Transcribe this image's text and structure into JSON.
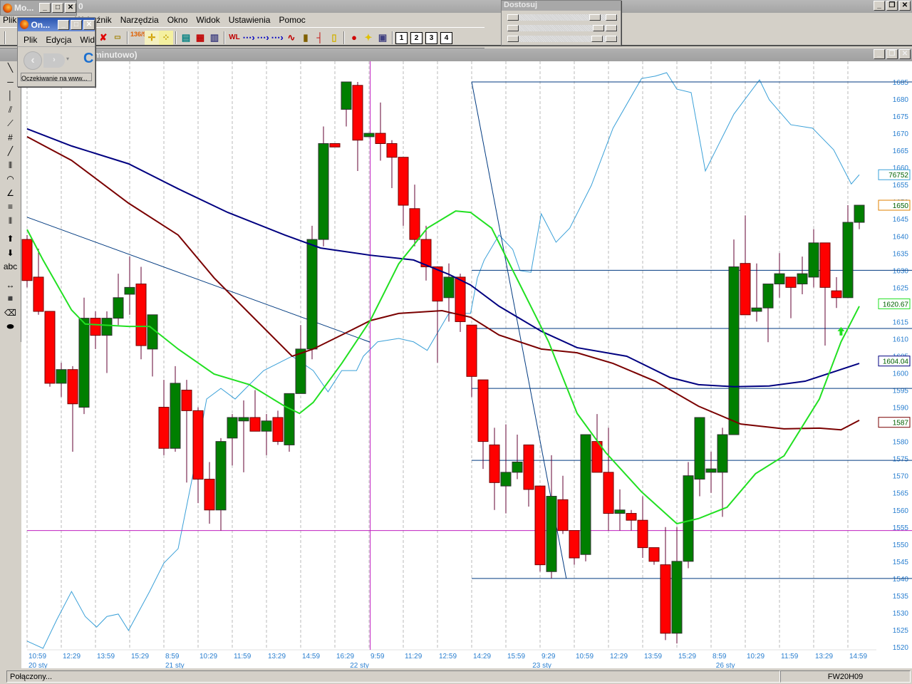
{
  "main_window": {
    "title_fragment": "Mo...",
    "title_tail": "0"
  },
  "menu": [
    "Plik",
    "Wskaźnik",
    "Narzędzia",
    "Okno",
    "Widok",
    "Ustawienia",
    "Pomoc"
  ],
  "toolbar": {
    "icons": [
      "close-chart",
      "ruler",
      "values-136-90",
      "crosshair",
      "dotted-crosshair",
      "table",
      "layout-grid",
      "list",
      "wl-marker",
      "arrow-1",
      "arrow-2",
      "arrow-3",
      "line-chart",
      "bar-chart",
      "ohlc-bar",
      "candlestick",
      "traffic-light",
      "bulb-add",
      "add-window"
    ],
    "values_label": "136/90",
    "wl_label": "WL",
    "layout_buttons": [
      "1",
      "2",
      "3",
      "4"
    ]
  },
  "adjust_panel": {
    "title": "Dostosuj",
    "sliders": [
      0.82,
      0.88,
      0.86
    ]
  },
  "chart_window": {
    "title": "minutowo)"
  },
  "left_tools": [
    "line",
    "horizontal-line",
    "vertical-line",
    "parallel-lines",
    "fan",
    "andrews-pitchfork",
    "trendline",
    "vertical-lines",
    "arcs",
    "angle-fan",
    "fibonacci-levels",
    "time-zones",
    "arrow-up",
    "arrow-down",
    "text",
    "measure",
    "point",
    "eraser",
    "erase-all"
  ],
  "left_tools_text_label": "abc",
  "browser_popup": {
    "title": "On...",
    "menu": [
      "Plik",
      "Edycja",
      "Wid"
    ],
    "status": "Oczekiwanie na www..."
  },
  "status_bar": {
    "connection": "Połączony...",
    "symbol": "FW20H09"
  },
  "colors": {
    "up": "#007f00",
    "down": "#ff0000",
    "ma_fast": "#22e022",
    "ma_mid": "#000080",
    "ma_slow": "#7a0000",
    "overlay": "#3aa0d8",
    "level": "#003a80",
    "cursor": "#c020c0"
  },
  "chart_data": {
    "type": "candlestick",
    "symbol": "FW20H09",
    "ylim": [
      1520,
      1685
    ],
    "y_ticks": [
      1685,
      1680,
      1675,
      1670,
      1665,
      1660,
      1655,
      1650,
      1645,
      1640,
      1635,
      1630,
      1625,
      1620,
      1615,
      1610,
      1605,
      1600,
      1595,
      1590,
      1585,
      1580,
      1575,
      1570,
      1565,
      1560,
      1555,
      1550,
      1545,
      1540,
      1535,
      1530,
      1525,
      1520
    ],
    "x_ticks": [
      {
        "i": 0,
        "label": "10:59"
      },
      {
        "i": 3,
        "label": "12:29"
      },
      {
        "i": 6,
        "label": "13:59"
      },
      {
        "i": 9,
        "label": "15:29"
      },
      {
        "i": 12,
        "label": "8:59"
      },
      {
        "i": 15,
        "label": "10:29"
      },
      {
        "i": 18,
        "label": "11:59"
      },
      {
        "i": 21,
        "label": "13:29"
      },
      {
        "i": 24,
        "label": "14:59"
      },
      {
        "i": 27,
        "label": "16:29"
      },
      {
        "i": 30,
        "label": "9:59"
      },
      {
        "i": 33,
        "label": "11:29"
      },
      {
        "i": 36,
        "label": "12:59"
      },
      {
        "i": 39,
        "label": "14:29"
      },
      {
        "i": 42,
        "label": "15:59"
      },
      {
        "i": 45,
        "label": "9:29"
      },
      {
        "i": 48,
        "label": "10:59"
      },
      {
        "i": 51,
        "label": "12:29"
      },
      {
        "i": 54,
        "label": "13:59"
      },
      {
        "i": 57,
        "label": "15:29"
      },
      {
        "i": 60,
        "label": "8:59"
      },
      {
        "i": 63,
        "label": "10:29"
      },
      {
        "i": 66,
        "label": "11:59"
      },
      {
        "i": 69,
        "label": "13:29"
      },
      {
        "i": 72,
        "label": "14:59"
      }
    ],
    "date_labels": [
      {
        "i": 0,
        "label": "20 sty"
      },
      {
        "i": 12,
        "label": "21 sty"
      },
      {
        "i": 28.2,
        "label": "22 sty"
      },
      {
        "i": 44.2,
        "label": "23 sty"
      },
      {
        "i": 60.3,
        "label": "26 sty"
      }
    ],
    "ohlc": [
      [
        1639,
        1640.3,
        1625,
        1627
      ],
      [
        1628,
        1636.3,
        1617,
        1618
      ],
      [
        1618,
        1618,
        1596,
        1597
      ],
      [
        1597,
        1603,
        1593,
        1601
      ],
      [
        1601,
        1602,
        1577,
        1591
      ],
      [
        1590,
        1622,
        1588,
        1616
      ],
      [
        1616,
        1618,
        1607,
        1611
      ],
      [
        1611,
        1618,
        1600,
        1616
      ],
      [
        1616,
        1629,
        1614,
        1622
      ],
      [
        1623,
        1634,
        1617,
        1625
      ],
      [
        1626,
        1631,
        1604,
        1608
      ],
      [
        1607,
        1617,
        1599,
        1617
      ],
      [
        1590,
        1598,
        1576,
        1578
      ],
      [
        1578,
        1602,
        1577,
        1597
      ],
      [
        1595,
        1598,
        1568,
        1589
      ],
      [
        1589,
        1590,
        1562,
        1569
      ],
      [
        1569,
        1574,
        1556,
        1560
      ],
      [
        1560,
        1581,
        1554,
        1580
      ],
      [
        1581,
        1588,
        1573,
        1587
      ],
      [
        1586,
        1592,
        1571,
        1587
      ],
      [
        1587,
        1595,
        1583,
        1583
      ],
      [
        1583,
        1588,
        1576,
        1586
      ],
      [
        1587,
        1589,
        1579,
        1580
      ],
      [
        1579,
        1594,
        1577,
        1594
      ],
      [
        1594,
        1614,
        1594,
        1607
      ],
      [
        1607,
        1643,
        1604,
        1639
      ],
      [
        1639,
        1672,
        1637,
        1667
      ],
      [
        1667,
        1667,
        1666,
        1666
      ],
      [
        1677,
        1685,
        1672,
        1685
      ],
      [
        1684,
        1685,
        1659,
        1668
      ],
      [
        1669,
        1670,
        1669,
        1670
      ],
      [
        1670,
        1679,
        1662,
        1667
      ],
      [
        1667,
        1668,
        1654,
        1663
      ],
      [
        1663,
        1663,
        1643,
        1649
      ],
      [
        1648,
        1655,
        1637,
        1639
      ],
      [
        1639,
        1643,
        1627,
        1631
      ],
      [
        1631,
        1631,
        1603,
        1621
      ],
      [
        1622,
        1632,
        1615,
        1628
      ],
      [
        1628,
        1629,
        1612,
        1615
      ],
      [
        1614,
        1614,
        1593,
        1599
      ],
      [
        1598,
        1598,
        1572,
        1580
      ],
      [
        1579,
        1584,
        1560,
        1568
      ],
      [
        1567,
        1585,
        1559,
        1571
      ],
      [
        1571,
        1582,
        1569,
        1574
      ],
      [
        1579,
        1579,
        1561,
        1566
      ],
      [
        1567,
        1567,
        1542,
        1544
      ],
      [
        1542,
        1576,
        1540,
        1564
      ],
      [
        1563,
        1570,
        1553,
        1554
      ],
      [
        1554,
        1554,
        1544,
        1546
      ],
      [
        1547,
        1582,
        1545,
        1582
      ],
      [
        1580,
        1588,
        1571,
        1571
      ],
      [
        1571,
        1584,
        1554,
        1559
      ],
      [
        1559,
        1566,
        1554,
        1560
      ],
      [
        1559,
        1560,
        1554,
        1557
      ],
      [
        1557,
        1564,
        1546,
        1549
      ],
      [
        1549,
        1549,
        1544,
        1545
      ],
      [
        1544,
        1555,
        1522,
        1524
      ],
      [
        1524,
        1555,
        1521,
        1545
      ],
      [
        1545,
        1574,
        1543,
        1570
      ],
      [
        1569,
        1587,
        1564,
        1587
      ],
      [
        1571,
        1577,
        1565,
        1572
      ],
      [
        1571,
        1584,
        1558,
        1582
      ],
      [
        1582,
        1639,
        1582,
        1631
      ],
      [
        1632,
        1646,
        1617,
        1617
      ],
      [
        1618,
        1632,
        1615,
        1619
      ],
      [
        1619,
        1626,
        1609,
        1626
      ],
      [
        1626,
        1635,
        1622,
        1629
      ],
      [
        1628,
        1628,
        1616,
        1625
      ],
      [
        1626,
        1634,
        1623,
        1629
      ],
      [
        1628,
        1642,
        1625,
        1638
      ],
      [
        1638,
        1638,
        1608,
        1625
      ],
      [
        1624,
        1628,
        1619,
        1622
      ],
      [
        1622,
        1649,
        1622,
        1644
      ],
      [
        1644,
        1649,
        1642,
        1649
      ]
    ],
    "series": [
      {
        "name": "ma-mid",
        "color_key": "ma_mid",
        "points": [
          [
            0,
            1671.3
          ],
          [
            3.9,
            1666.3
          ],
          [
            8.9,
            1661.1
          ],
          [
            13.25,
            1653.8
          ],
          [
            17.6,
            1646.9
          ],
          [
            22.6,
            1640.3
          ],
          [
            25.75,
            1636.5
          ],
          [
            30.1,
            1634.4
          ],
          [
            33.9,
            1633
          ],
          [
            37,
            1628.8
          ],
          [
            38.9,
            1625.7
          ],
          [
            41.4,
            1619.5
          ],
          [
            45.1,
            1612.2
          ],
          [
            48.25,
            1607.4
          ],
          [
            52.6,
            1604.9
          ],
          [
            56.4,
            1598.7
          ],
          [
            58.9,
            1596.6
          ],
          [
            62,
            1596
          ],
          [
            65.1,
            1596.2
          ],
          [
            68.25,
            1597.6
          ],
          [
            73,
            1602.8
          ]
        ]
      },
      {
        "name": "ma-slow",
        "color_key": "ma_slow",
        "points": [
          [
            0,
            1669
          ],
          [
            3.9,
            1662.1
          ],
          [
            8.9,
            1649.6
          ],
          [
            13.25,
            1640.3
          ],
          [
            16.4,
            1627.8
          ],
          [
            19.5,
            1617.4
          ],
          [
            23.25,
            1604.9
          ],
          [
            25.1,
            1607
          ],
          [
            27.6,
            1611.1
          ],
          [
            30.1,
            1615.3
          ],
          [
            32.6,
            1617.4
          ],
          [
            36.4,
            1618.2
          ],
          [
            38.9,
            1616.3
          ],
          [
            41.4,
            1611.1
          ],
          [
            45.1,
            1607
          ],
          [
            48.25,
            1605.9
          ],
          [
            51.4,
            1602.8
          ],
          [
            55.1,
            1597.6
          ],
          [
            58.9,
            1590.3
          ],
          [
            62.6,
            1585.1
          ],
          [
            66.4,
            1583.7
          ],
          [
            69.5,
            1583.9
          ],
          [
            71.4,
            1583.4
          ],
          [
            73,
            1586.2
          ]
        ]
      },
      {
        "name": "ma-fast",
        "color_key": "ma_fast",
        "points": [
          [
            0,
            1641.9
          ],
          [
            1.4,
            1633
          ],
          [
            3.9,
            1618.4
          ],
          [
            5.1,
            1614.3
          ],
          [
            8.9,
            1613.6
          ],
          [
            10.75,
            1613.6
          ],
          [
            13.25,
            1607
          ],
          [
            16.4,
            1599.7
          ],
          [
            19.5,
            1596.6
          ],
          [
            22.6,
            1590.3
          ],
          [
            23.9,
            1588.2
          ],
          [
            25.1,
            1591.4
          ],
          [
            27.6,
            1602.8
          ],
          [
            30.1,
            1615.3
          ],
          [
            32.6,
            1631.9
          ],
          [
            35.1,
            1642.3
          ],
          [
            37.6,
            1647.3
          ],
          [
            38.9,
            1646.9
          ],
          [
            40.75,
            1642.3
          ],
          [
            43.25,
            1625.7
          ],
          [
            45.75,
            1609.1
          ],
          [
            48.25,
            1588.2
          ],
          [
            50.75,
            1576.8
          ],
          [
            53.9,
            1565.3
          ],
          [
            57,
            1556
          ],
          [
            58.9,
            1557.5
          ],
          [
            61.4,
            1560.8
          ],
          [
            63.9,
            1570.6
          ],
          [
            66.4,
            1575.8
          ],
          [
            69.5,
            1592.4
          ],
          [
            71.4,
            1609.1
          ],
          [
            73,
            1619.5
          ]
        ]
      },
      {
        "name": "overlay-indicator",
        "color_key": "overlay",
        "points": [
          [
            0,
            1521.7
          ],
          [
            1.4,
            1519.6
          ],
          [
            2.6,
            1527.9
          ],
          [
            3.9,
            1536.2
          ],
          [
            5.1,
            1528.9
          ],
          [
            6.1,
            1525.8
          ],
          [
            7,
            1528.9
          ],
          [
            8,
            1529.6
          ],
          [
            8.9,
            1524.8
          ],
          [
            10.75,
            1536.2
          ],
          [
            12,
            1544.5
          ],
          [
            13.25,
            1548.7
          ],
          [
            14.5,
            1569.5
          ],
          [
            15.75,
            1592.4
          ],
          [
            17,
            1595.5
          ],
          [
            18.25,
            1592.4
          ],
          [
            19.5,
            1596.6
          ],
          [
            20.75,
            1600.7
          ],
          [
            22,
            1602.8
          ],
          [
            23.25,
            1604.9
          ],
          [
            25.1,
            1600.7
          ],
          [
            26.4,
            1594.5
          ],
          [
            27.6,
            1600.7
          ],
          [
            28.9,
            1600.7
          ],
          [
            29.5,
            1604.9
          ],
          [
            30.75,
            1609.1
          ],
          [
            32.6,
            1610.1
          ],
          [
            33.9,
            1609.1
          ],
          [
            35.1,
            1606.6
          ],
          [
            37,
            1617.4
          ],
          [
            37.9,
            1617.4
          ],
          [
            38.9,
            1617.4
          ],
          [
            39.5,
            1627.8
          ],
          [
            40.1,
            1633
          ],
          [
            41.4,
            1640.3
          ],
          [
            42.6,
            1636.1
          ],
          [
            43.25,
            1629.9
          ],
          [
            44.2,
            1629.4
          ],
          [
            45.1,
            1646.5
          ],
          [
            46.4,
            1638.2
          ],
          [
            47.6,
            1642.3
          ],
          [
            49.5,
            1654.8
          ],
          [
            51.4,
            1671.5
          ],
          [
            53.9,
            1686
          ],
          [
            55.1,
            1686.7
          ],
          [
            56.1,
            1687.7
          ],
          [
            57,
            1682.9
          ],
          [
            58.25,
            1681.9
          ],
          [
            59.5,
            1659
          ],
          [
            60.75,
            1667.3
          ],
          [
            62,
            1675.6
          ],
          [
            64.25,
            1685.6
          ],
          [
            65.1,
            1679.8
          ],
          [
            67,
            1672.5
          ],
          [
            68.9,
            1671.5
          ],
          [
            70.75,
            1665.2
          ],
          [
            72.3,
            1655.2
          ],
          [
            73,
            1657.9
          ]
        ]
      }
    ],
    "levels": {
      "from_i": 39,
      "prices": [
        1685,
        1630,
        1613,
        1595.5,
        1574.5,
        1540
      ]
    },
    "trendlines": [
      [
        [
          39,
          1685
        ],
        [
          47.3,
          1540
        ]
      ],
      [
        [
          0,
          1645.5
        ],
        [
          30.1,
          1609
        ]
      ]
    ],
    "cursor": {
      "i": 30.1,
      "price": 1554
    },
    "signal_arrow": {
      "i": 71.4,
      "price": 1612
    },
    "value_labels": [
      {
        "text": "76752",
        "price": 1657.9,
        "color_key": "overlay"
      },
      {
        "text": "1650",
        "price": 1649,
        "color": "#e08000"
      },
      {
        "text": "1620.67",
        "price": 1620.2,
        "color_key": "ma_fast"
      },
      {
        "text": "1604.04",
        "price": 1603.5,
        "color_key": "ma_mid"
      },
      {
        "text": "1587",
        "price": 1585.6,
        "color_key": "ma_slow"
      }
    ]
  }
}
